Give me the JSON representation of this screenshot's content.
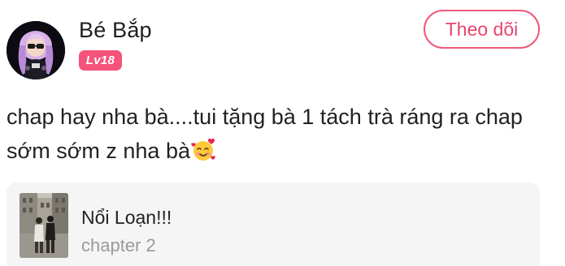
{
  "user": {
    "name": "Bé Bắp",
    "level": "Lv18"
  },
  "follow_button": {
    "label": "Theo dõi"
  },
  "comment": {
    "text": "chap hay nha bà....tui tặng bà 1 tách trà ráng ra chap sớm sớm z nha bà",
    "emoji": "smiling-face-with-hearts"
  },
  "story": {
    "title": "Nổi Loạn!!!",
    "chapter": "chapter 2"
  },
  "colors": {
    "accent": "#f0587a",
    "badge": "#f4537a",
    "card_background": "#f5f5f5",
    "muted_text": "#9a9a9a"
  }
}
